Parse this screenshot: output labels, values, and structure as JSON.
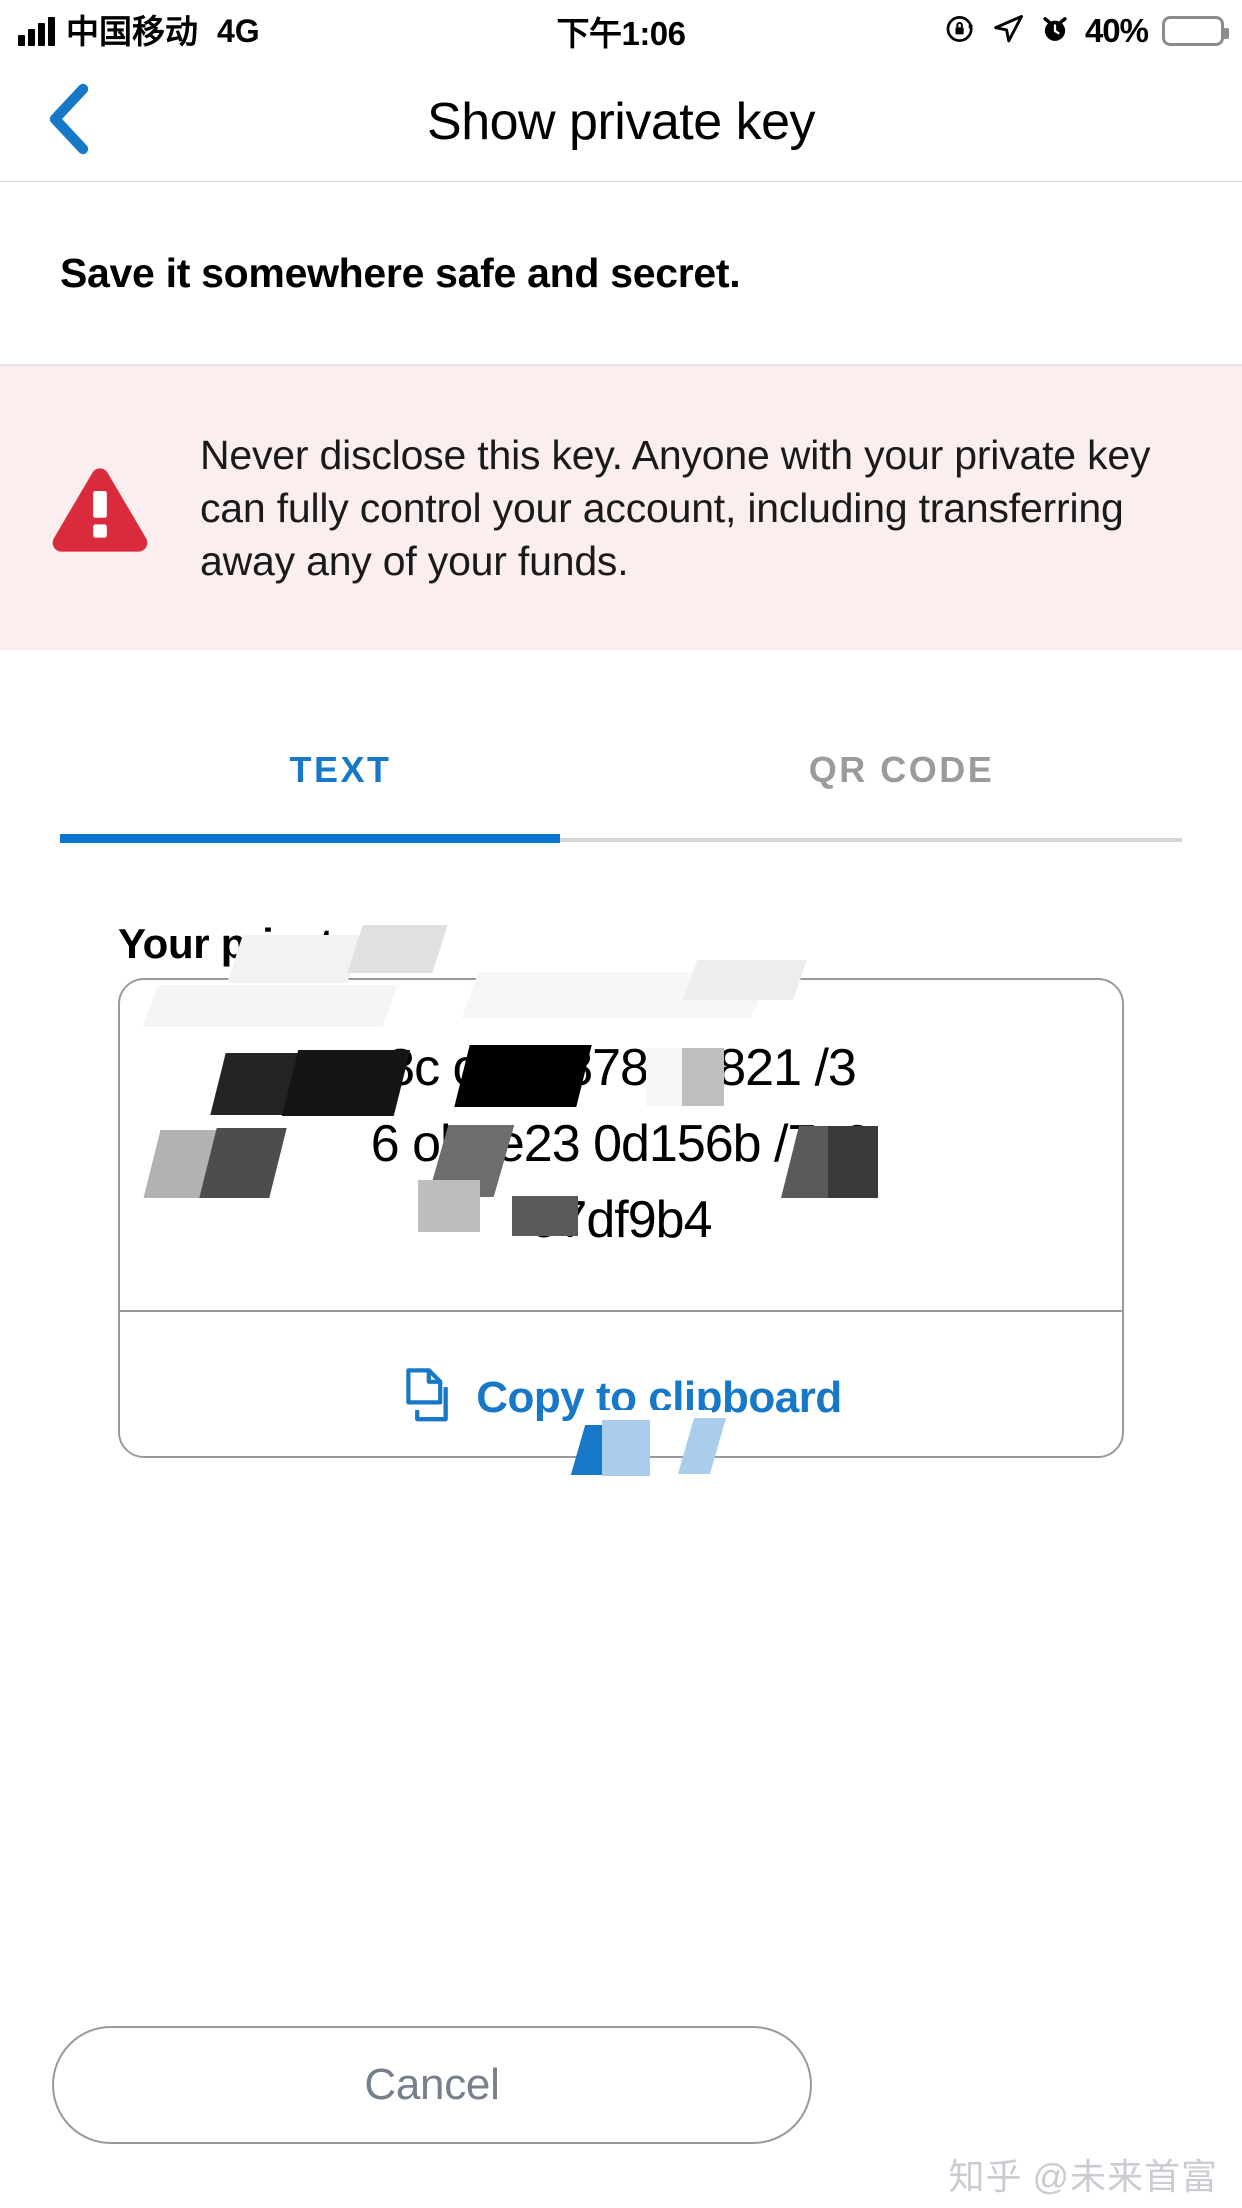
{
  "statusbar": {
    "carrier": "中国移动",
    "network": "4G",
    "time": "下午1:06",
    "battery_percent": "40%",
    "icons": [
      "signal-bars-icon",
      "rotation-lock-icon",
      "location-arrow-icon",
      "alarm-clock-icon",
      "battery-icon"
    ]
  },
  "navbar": {
    "back_icon": "chevron-left-icon",
    "title": "Show private key"
  },
  "subtitle": "Save it somewhere safe and secret.",
  "warning": {
    "icon": "warning-triangle-icon",
    "text": "Never disclose this key. Anyone with your private key can fully control your account, including transferring away any of your funds.",
    "background_color": "#fbeeee",
    "icon_color": "#da2b3c"
  },
  "tabs": {
    "items": [
      {
        "label": "TEXT",
        "active": true
      },
      {
        "label": "QR CODE",
        "active": false
      }
    ],
    "active_color": "#1878c8",
    "inactive_color": "#9b9b9b",
    "indicator_color": "#0b76cf"
  },
  "key_panel": {
    "label": "Your private key",
    "value_line1": "8c      ob81878      80821       /3",
    "value_line2": "6    ob7e23     0d156b     /7e9",
    "value_line3": "97df9b4",
    "copy_icon": "copy-icon",
    "copy_label": "Copy to clipboard",
    "copy_label_color": "#1878c8"
  },
  "footer": {
    "cancel_label": "Cancel",
    "cancel_text_color": "#77808c"
  },
  "watermark": {
    "site": "知乎",
    "handle": "@未来首富"
  }
}
